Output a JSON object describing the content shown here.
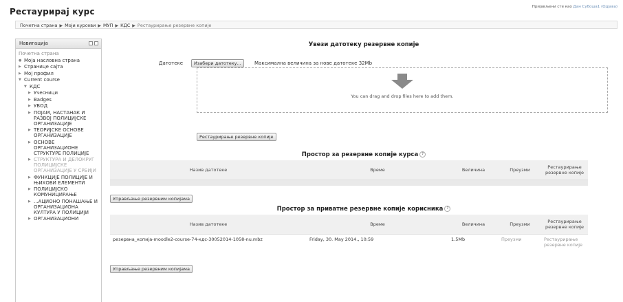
{
  "header": {
    "title": "Рестаурирај курс",
    "login_text": "Пријављени сте као",
    "user_name": "Дан Субоша1",
    "logout": "(Одјава)"
  },
  "breadcrumb": [
    "Почетна страна",
    "Моји курсеви",
    "МУП",
    "КДС",
    "Рестаурирање резервне копије"
  ],
  "navigation": {
    "title": "Навигација",
    "home": "Почетна страна",
    "items": [
      {
        "label": "Моја насловна страна",
        "level": 1,
        "icon": "bullet"
      },
      {
        "label": "Странице сајта",
        "level": 1,
        "icon": "arrow-right"
      },
      {
        "label": "Мој профил",
        "level": 1,
        "icon": "arrow-right"
      },
      {
        "label": "Current course",
        "level": 1,
        "icon": "arrow-down"
      },
      {
        "label": "КДС",
        "level": 2,
        "icon": "arrow-down"
      },
      {
        "label": "Учесници",
        "level": 3,
        "icon": "arrow-right"
      },
      {
        "label": "Badges",
        "level": 3,
        "icon": "arrow-right"
      },
      {
        "label": "УВОД",
        "level": 3,
        "icon": "arrow-right"
      },
      {
        "label": "ПОЈАМ, НАСТАНАК И РАЗВОЈ ПОЛИЦИЈСКЕ ОРГАНИЗАЦИЈЕ",
        "level": 3,
        "icon": "arrow-right"
      },
      {
        "label": "ТЕОРИЈСКЕ ОСНОВЕ ОРГАНИЗАЦИЈЕ",
        "level": 3,
        "icon": "arrow-right"
      },
      {
        "label": "ОСНОВЕ ОРГАНИЗАЦИОНЕ СТРУКТУРЕ ПОЛИЦИЈЕ",
        "level": 3,
        "icon": "arrow-right"
      },
      {
        "label": "СТРУКТУРА И ДЕЛОКРУГ ПОЛИЦИЈСКЕ ОРГАНИЗАЦИЈЕ У СРБИЈИ",
        "level": 3,
        "icon": "arrow-right",
        "dim": true
      },
      {
        "label": "ФУНКЦИЈЕ ПОЛИЦИЈЕ И ЊИХОВИ ЕЛЕМЕНТИ",
        "level": 3,
        "icon": "arrow-right"
      },
      {
        "label": "ПОЛИЦИЈСКО КОМУНИЦИРАЊЕ",
        "level": 3,
        "icon": "arrow-right"
      },
      {
        "label": "...АЦИОНО ПОНАШАЊЕ И ОРГАНИЗАЦИОНА КУЛТУРА У ПОЛИЦИЈИ",
        "level": 3,
        "icon": "arrow-right"
      },
      {
        "label": "ОРГАНИЗАЦИОНИ",
        "level": 3,
        "icon": "arrow-right"
      }
    ]
  },
  "upload": {
    "title": "Увези датотеку резервне копије",
    "files_label": "Датотеке",
    "choose_button": "Изабери датотеку...",
    "max_size": "Максимална величина за нове датотеке 32Mb",
    "drop_text": "You can drag and drop files here to add them.",
    "restore_button": "Рестаурирање резервне копије"
  },
  "course_backups": {
    "title": "Простор за резервне копије курса",
    "columns": [
      "Назив датотеке",
      "Време",
      "Величина",
      "Преузми",
      "Рестаурирање резервне копије"
    ],
    "manage_button": "Управљање резервним копијама"
  },
  "user_backups": {
    "title": "Простор за приватне резервне копије корисника",
    "columns": [
      "Назив датотеке",
      "Време",
      "Величина",
      "Преузми",
      "Рестаурирање резервне копије"
    ],
    "rows": [
      {
        "name": "резервна_копија-moodle2-course-74-кдс-30052014-1058-nu.mbz",
        "time": "Friday, 30. May 2014., 10:59",
        "size": "1.5Mb",
        "download": "Преузми",
        "restore": "Рестаурирање резервне копије"
      }
    ],
    "manage_button": "Управљање резервним копијама"
  },
  "colors": {
    "link": "#6a8fb8",
    "header_bg": "#f0f0f0",
    "empty_row": "#e9e9e9"
  }
}
